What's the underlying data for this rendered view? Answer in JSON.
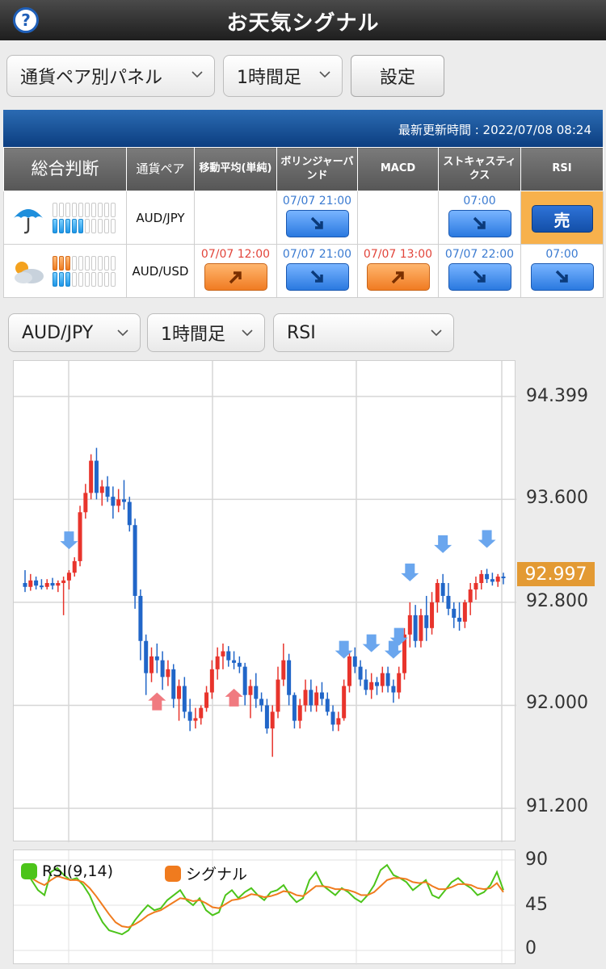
{
  "header": {
    "title": "お天気シグナル",
    "help_icon": "question-circle-icon"
  },
  "controls": {
    "view_select": "通貨ペア別パネル",
    "timeframe_select": "1時間足",
    "settings_label": "設定"
  },
  "table": {
    "updated": "最新更新時間 : 2022/07/08 08:24",
    "headers": [
      "総合判断",
      "通貨ペア",
      "移動平均(単純)",
      "ボリンジャーバンド",
      "MACD",
      "ストキャスティクス",
      "RSI"
    ],
    "rows": [
      {
        "weather_icon": "umbrella-icon",
        "pair": "AUD/JPY",
        "bars_top": {
          "filled": 0,
          "total": 10,
          "color": "#1d96e8"
        },
        "bars_bottom": {
          "filled": 5,
          "total": 10,
          "color": "#1d96e8"
        },
        "ma": {
          "time": "",
          "signal": ""
        },
        "bb": {
          "time": "07/07 21:00",
          "signal": "down"
        },
        "macd": {
          "time": "",
          "signal": ""
        },
        "stoch": {
          "time": "07:00",
          "signal": "down"
        },
        "rsi": {
          "time": "",
          "signal": "sell",
          "label": "売"
        }
      },
      {
        "weather_icon": "cloudy-icon",
        "pair": "AUD/USD",
        "bars_top": {
          "filled": 3,
          "total": 10,
          "color": "#f07b1e"
        },
        "bars_bottom": {
          "filled": 3,
          "total": 10,
          "color": "#1d96e8"
        },
        "ma": {
          "time": "07/07 12:00",
          "signal": "up"
        },
        "bb": {
          "time": "07/07 21:00",
          "signal": "down"
        },
        "macd": {
          "time": "07/07 13:00",
          "signal": "up"
        },
        "stoch": {
          "time": "07/07 22:00",
          "signal": "down"
        },
        "rsi": {
          "time": "07:00",
          "signal": "down"
        }
      }
    ]
  },
  "chart_controls": {
    "pair_select": "AUD/JPY",
    "timeframe_select": "1時間足",
    "indicator_select": "RSI"
  },
  "price_axis": {
    "labels": [
      "94.399",
      "93.600",
      "92.800",
      "92.000",
      "91.200"
    ],
    "current": "92.997"
  },
  "rsi_axis": {
    "labels": [
      "90",
      "45",
      "0"
    ]
  },
  "legend": {
    "rsi": "RSI(9,14)",
    "signal": "シグナル",
    "rsi_color": "#4cc41a",
    "signal_color": "#f07b1e"
  },
  "colors": {
    "bull": "#e8342c",
    "bear": "#2166c8",
    "sell_arrow": "#6aa6ee",
    "buy_arrow": "#f07a80"
  },
  "chart_data": {
    "type": "line",
    "price_ylim": [
      91.2,
      94.399
    ],
    "candles": [
      [
        92.95,
        93.05,
        92.88,
        92.92
      ],
      [
        92.92,
        93.02,
        92.89,
        92.97
      ],
      [
        92.97,
        93.0,
        92.9,
        92.93
      ],
      [
        92.93,
        92.98,
        92.9,
        92.92
      ],
      [
        92.92,
        92.98,
        92.9,
        92.95
      ],
      [
        92.95,
        92.99,
        92.9,
        92.93
      ],
      [
        92.93,
        92.97,
        92.88,
        92.95
      ],
      [
        92.95,
        93.0,
        92.7,
        92.97
      ],
      [
        92.97,
        93.05,
        92.9,
        93.03
      ],
      [
        93.03,
        93.15,
        93.0,
        93.12
      ],
      [
        93.12,
        93.55,
        93.08,
        93.5
      ],
      [
        93.5,
        93.72,
        93.45,
        93.65
      ],
      [
        93.65,
        93.95,
        93.6,
        93.9
      ],
      [
        93.9,
        94.0,
        93.6,
        93.65
      ],
      [
        93.65,
        93.75,
        93.55,
        93.7
      ],
      [
        93.7,
        93.78,
        93.58,
        93.62
      ],
      [
        93.62,
        93.7,
        93.45,
        93.55
      ],
      [
        93.55,
        93.68,
        93.5,
        93.6
      ],
      [
        93.6,
        93.75,
        93.52,
        93.58
      ],
      [
        93.58,
        93.62,
        93.35,
        93.4
      ],
      [
        93.4,
        93.45,
        92.75,
        92.85
      ],
      [
        92.85,
        92.9,
        92.35,
        92.5
      ],
      [
        92.5,
        92.55,
        92.08,
        92.25
      ],
      [
        92.25,
        92.45,
        92.18,
        92.38
      ],
      [
        92.38,
        92.48,
        92.25,
        92.35
      ],
      [
        92.35,
        92.42,
        92.12,
        92.22
      ],
      [
        92.22,
        92.35,
        92.15,
        92.28
      ],
      [
        92.28,
        92.32,
        91.98,
        92.05
      ],
      [
        92.05,
        92.2,
        91.88,
        92.15
      ],
      [
        92.15,
        92.22,
        91.9,
        91.95
      ],
      [
        91.95,
        92.05,
        91.8,
        91.88
      ],
      [
        91.88,
        91.98,
        91.82,
        91.9
      ],
      [
        91.9,
        92.0,
        91.85,
        91.98
      ],
      [
        91.98,
        92.15,
        91.95,
        92.1
      ],
      [
        92.1,
        92.35,
        92.05,
        92.28
      ],
      [
        92.28,
        92.45,
        92.2,
        92.38
      ],
      [
        92.38,
        92.48,
        92.28,
        92.42
      ],
      [
        92.42,
        92.46,
        92.3,
        92.35
      ],
      [
        92.35,
        92.42,
        92.28,
        92.33
      ],
      [
        92.33,
        92.38,
        92.25,
        92.3
      ],
      [
        92.3,
        92.33,
        92.0,
        92.08
      ],
      [
        92.08,
        92.2,
        91.9,
        92.15
      ],
      [
        92.15,
        92.25,
        91.98,
        92.05
      ],
      [
        92.05,
        92.1,
        91.95,
        92.0
      ],
      [
        92.0,
        92.05,
        91.78,
        91.82
      ],
      [
        91.82,
        92.0,
        91.6,
        91.95
      ],
      [
        91.95,
        92.3,
        91.9,
        92.2
      ],
      [
        92.2,
        92.48,
        92.15,
        92.35
      ],
      [
        92.35,
        92.4,
        92.0,
        92.08
      ],
      [
        92.08,
        92.1,
        91.82,
        91.88
      ],
      [
        91.88,
        92.05,
        91.82,
        92.0
      ],
      [
        92.0,
        92.2,
        91.95,
        92.12
      ],
      [
        92.12,
        92.2,
        91.95,
        92.0
      ],
      [
        92.0,
        92.15,
        91.95,
        92.1
      ],
      [
        92.1,
        92.18,
        92.0,
        92.05
      ],
      [
        92.05,
        92.1,
        91.92,
        91.95
      ],
      [
        91.95,
        92.0,
        91.8,
        91.85
      ],
      [
        91.85,
        91.95,
        91.8,
        91.9
      ],
      [
        91.9,
        92.2,
        91.88,
        92.15
      ],
      [
        92.15,
        92.42,
        92.1,
        92.38
      ],
      [
        92.38,
        92.45,
        92.25,
        92.3
      ],
      [
        92.3,
        92.35,
        92.15,
        92.2
      ],
      [
        92.2,
        92.28,
        92.08,
        92.12
      ],
      [
        92.12,
        92.25,
        92.05,
        92.18
      ],
      [
        92.18,
        92.22,
        92.08,
        92.15
      ],
      [
        92.15,
        92.3,
        92.1,
        92.25
      ],
      [
        92.25,
        92.3,
        92.1,
        92.15
      ],
      [
        92.15,
        92.2,
        92.02,
        92.1
      ],
      [
        92.1,
        92.3,
        92.05,
        92.25
      ],
      [
        92.25,
        92.6,
        92.2,
        92.55
      ],
      [
        92.55,
        92.8,
        92.45,
        92.7
      ],
      [
        92.7,
        92.78,
        92.45,
        92.5
      ],
      [
        92.5,
        92.75,
        92.45,
        92.7
      ],
      [
        92.7,
        92.85,
        92.5,
        92.6
      ],
      [
        92.6,
        92.88,
        92.55,
        92.8
      ],
      [
        92.8,
        92.98,
        92.72,
        92.95
      ],
      [
        92.95,
        93.02,
        92.8,
        92.85
      ],
      [
        92.85,
        92.95,
        92.7,
        92.75
      ],
      [
        92.75,
        92.8,
        92.6,
        92.68
      ],
      [
        92.68,
        92.8,
        92.58,
        92.65
      ],
      [
        92.65,
        92.82,
        92.6,
        92.8
      ],
      [
        92.8,
        92.95,
        92.7,
        92.9
      ],
      [
        92.9,
        93.0,
        92.82,
        92.95
      ],
      [
        92.95,
        93.05,
        92.9,
        93.02
      ],
      [
        93.02,
        93.06,
        92.95,
        92.98
      ],
      [
        92.98,
        93.03,
        92.93,
        92.96
      ],
      [
        92.96,
        93.02,
        92.92,
        93.0
      ],
      [
        93.0,
        93.03,
        92.94,
        92.99
      ]
    ],
    "sell_arrow_indices": [
      8,
      58,
      63,
      67,
      68,
      70,
      76,
      84
    ],
    "buy_arrow_indices": [
      24,
      38
    ],
    "rsi_ylim": [
      0,
      90
    ],
    "series": [
      {
        "name": "RSI(9,14)",
        "values": [
          80,
          70,
          60,
          55,
          78,
          82,
          75,
          70,
          72,
          65,
          55,
          40,
          28,
          20,
          18,
          16,
          20,
          30,
          38,
          45,
          40,
          42,
          50,
          55,
          60,
          50,
          45,
          52,
          40,
          35,
          38,
          55,
          60,
          52,
          58,
          62,
          55,
          50,
          58,
          60,
          65,
          55,
          48,
          52,
          70,
          78,
          65,
          60,
          55,
          62,
          58,
          52,
          48,
          55,
          65,
          80,
          85,
          75,
          72,
          68,
          60,
          65,
          70,
          55,
          52,
          60,
          68,
          72,
          66,
          62,
          55,
          58,
          65,
          78,
          60
        ]
      },
      {
        "name": "シグナル",
        "values": [
          75,
          72,
          68,
          65,
          70,
          74,
          72,
          70,
          70,
          68,
          62,
          54,
          45,
          36,
          28,
          24,
          23,
          26,
          30,
          35,
          38,
          40,
          44,
          48,
          52,
          51,
          49,
          50,
          47,
          43,
          42,
          46,
          50,
          51,
          53,
          56,
          55,
          53,
          54,
          56,
          59,
          58,
          55,
          54,
          59,
          64,
          64,
          63,
          61,
          61,
          60,
          58,
          55,
          55,
          58,
          64,
          70,
          72,
          72,
          71,
          68,
          67,
          68,
          64,
          61,
          61,
          63,
          66,
          66,
          65,
          62,
          61,
          62,
          67,
          58
        ]
      }
    ]
  }
}
